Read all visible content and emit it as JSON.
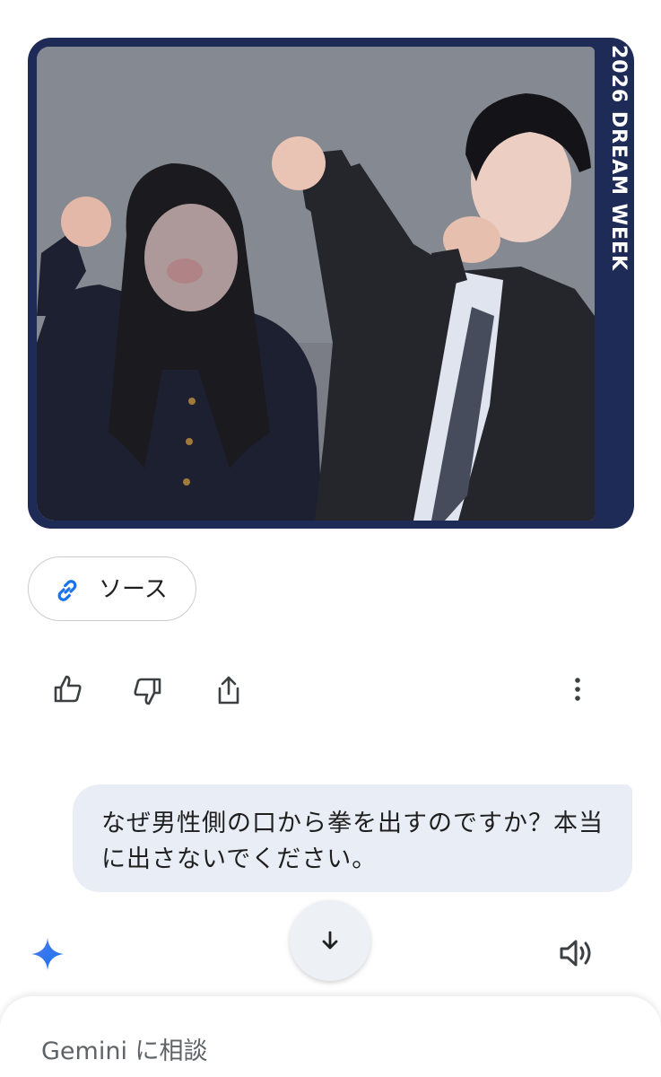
{
  "image_card": {
    "banner_text": "2026 DREAM WEEK",
    "frame_color": "#1f2b57"
  },
  "sources": {
    "label": "ソース",
    "icon": "link-icon",
    "icon_color": "#1a73e8"
  },
  "actions": {
    "icons": [
      "thumbs-up-icon",
      "thumbs-down-icon",
      "share-icon",
      "more-vertical-icon"
    ]
  },
  "user_message": {
    "text": "なぜ男性側の口から拳を出すのですか？本当に出さないでください。"
  },
  "scroll_button": {
    "icon": "arrow-down-icon"
  },
  "response": {
    "avatar_icon": "gemini-sparkle-icon",
    "listen_icon": "speaker-icon"
  },
  "composer": {
    "placeholder": "Gemini に相談"
  }
}
